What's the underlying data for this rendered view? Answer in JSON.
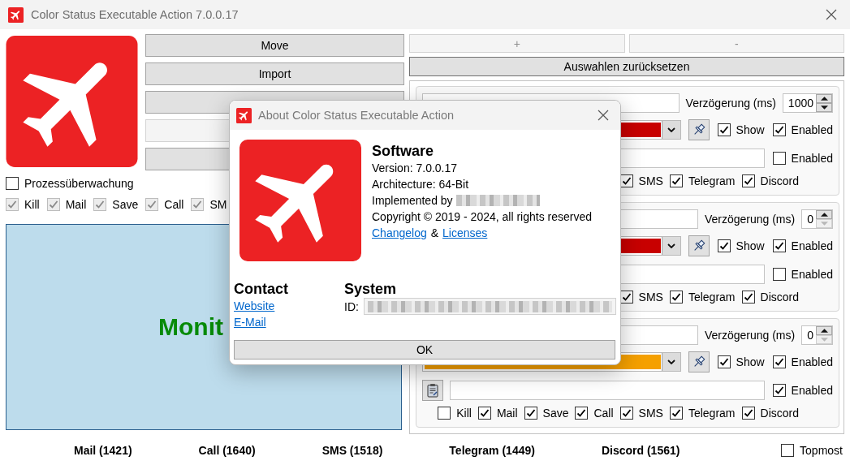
{
  "window": {
    "title": "Color Status Executable Action 7.0.0.17"
  },
  "main_buttons": [
    {
      "label": "Move",
      "disabled": false
    },
    {
      "label": "Import",
      "disabled": false
    },
    {
      "disabled": false
    },
    {
      "disabled": true
    },
    {
      "disabled": false
    }
  ],
  "process_monitoring": {
    "label": "Prozessüberwachung",
    "checked": false
  },
  "channel_checks": [
    {
      "label": "Kill",
      "checked": true,
      "disabled": true
    },
    {
      "label": "Mail",
      "checked": true,
      "disabled": true
    },
    {
      "label": "Save",
      "checked": true,
      "disabled": true
    },
    {
      "label": "Call",
      "checked": true,
      "disabled": true
    },
    {
      "label": "SM",
      "checked": true,
      "disabled": true
    }
  ],
  "monitor": {
    "text": "Monit"
  },
  "list_buttons": [
    {
      "label": "+",
      "disabled": true
    },
    {
      "label": "-",
      "disabled": true
    }
  ],
  "reset_button": {
    "label": "Auswahlen zurücksetzen"
  },
  "rules": [
    {
      "delay_label": "Verzögerung (ms)",
      "delay": "1000",
      "decrement_disabled": false,
      "color": "#c80000",
      "show": {
        "label": "Show",
        "checked": true
      },
      "enabled": {
        "label": "Enabled",
        "checked": true
      },
      "command_enabled": {
        "label": "Enabled",
        "checked": false
      },
      "actions": [
        {
          "label": "SMS",
          "checked": true
        },
        {
          "label": "Telegram",
          "checked": true
        },
        {
          "label": "Discord",
          "checked": true
        }
      ]
    },
    {
      "delay_label": "Verzögerung (ms)",
      "delay": "0",
      "decrement_disabled": true,
      "color": "#c80000",
      "show": {
        "label": "Show",
        "checked": true
      },
      "enabled": {
        "label": "Enabled",
        "checked": true
      },
      "command_enabled": {
        "label": "Enabled",
        "checked": false
      },
      "actions": [
        {
          "label": "SMS",
          "checked": true
        },
        {
          "label": "Telegram",
          "checked": true
        },
        {
          "label": "Discord",
          "checked": true
        }
      ]
    },
    {
      "delay_label": "Verzögerung (ms)",
      "delay": "0",
      "decrement_disabled": true,
      "color": "#f5a000",
      "show": {
        "label": "Show",
        "checked": true
      },
      "enabled": {
        "label": "Enabled",
        "checked": true
      },
      "clipboard_button": true,
      "command_enabled": {
        "label": "Enabled",
        "checked": true
      },
      "actions": [
        {
          "label": "Kill",
          "checked": false
        },
        {
          "label": "Mail",
          "checked": true
        },
        {
          "label": "Save",
          "checked": true
        },
        {
          "label": "Call",
          "checked": true
        },
        {
          "label": "SMS",
          "checked": true
        },
        {
          "label": "Telegram",
          "checked": true
        },
        {
          "label": "Discord",
          "checked": true
        }
      ]
    }
  ],
  "counters": [
    "Mail (1421)",
    "Call (1640)",
    "SMS (1518)",
    "Telegram (1449)",
    "Discord (1561)"
  ],
  "topmost": {
    "label": "Topmost",
    "checked": false
  },
  "about_dialog": {
    "title": "About Color Status Executable Action",
    "software": {
      "heading": "Software",
      "lines": [
        "Version: 7.0.0.17",
        "Architecture: 64-Bit"
      ],
      "implemented_by": "Implemented by",
      "copyright": "Copyright © 2019 - 2024, all rights reserved",
      "links": [
        "Changelog",
        "Licenses"
      ],
      "link_separator": "&"
    },
    "contact": {
      "heading": "Contact",
      "links": [
        "Website",
        "E-Mail"
      ]
    },
    "system": {
      "heading": "System",
      "id_label": "ID:"
    },
    "ok_button": "OK"
  }
}
